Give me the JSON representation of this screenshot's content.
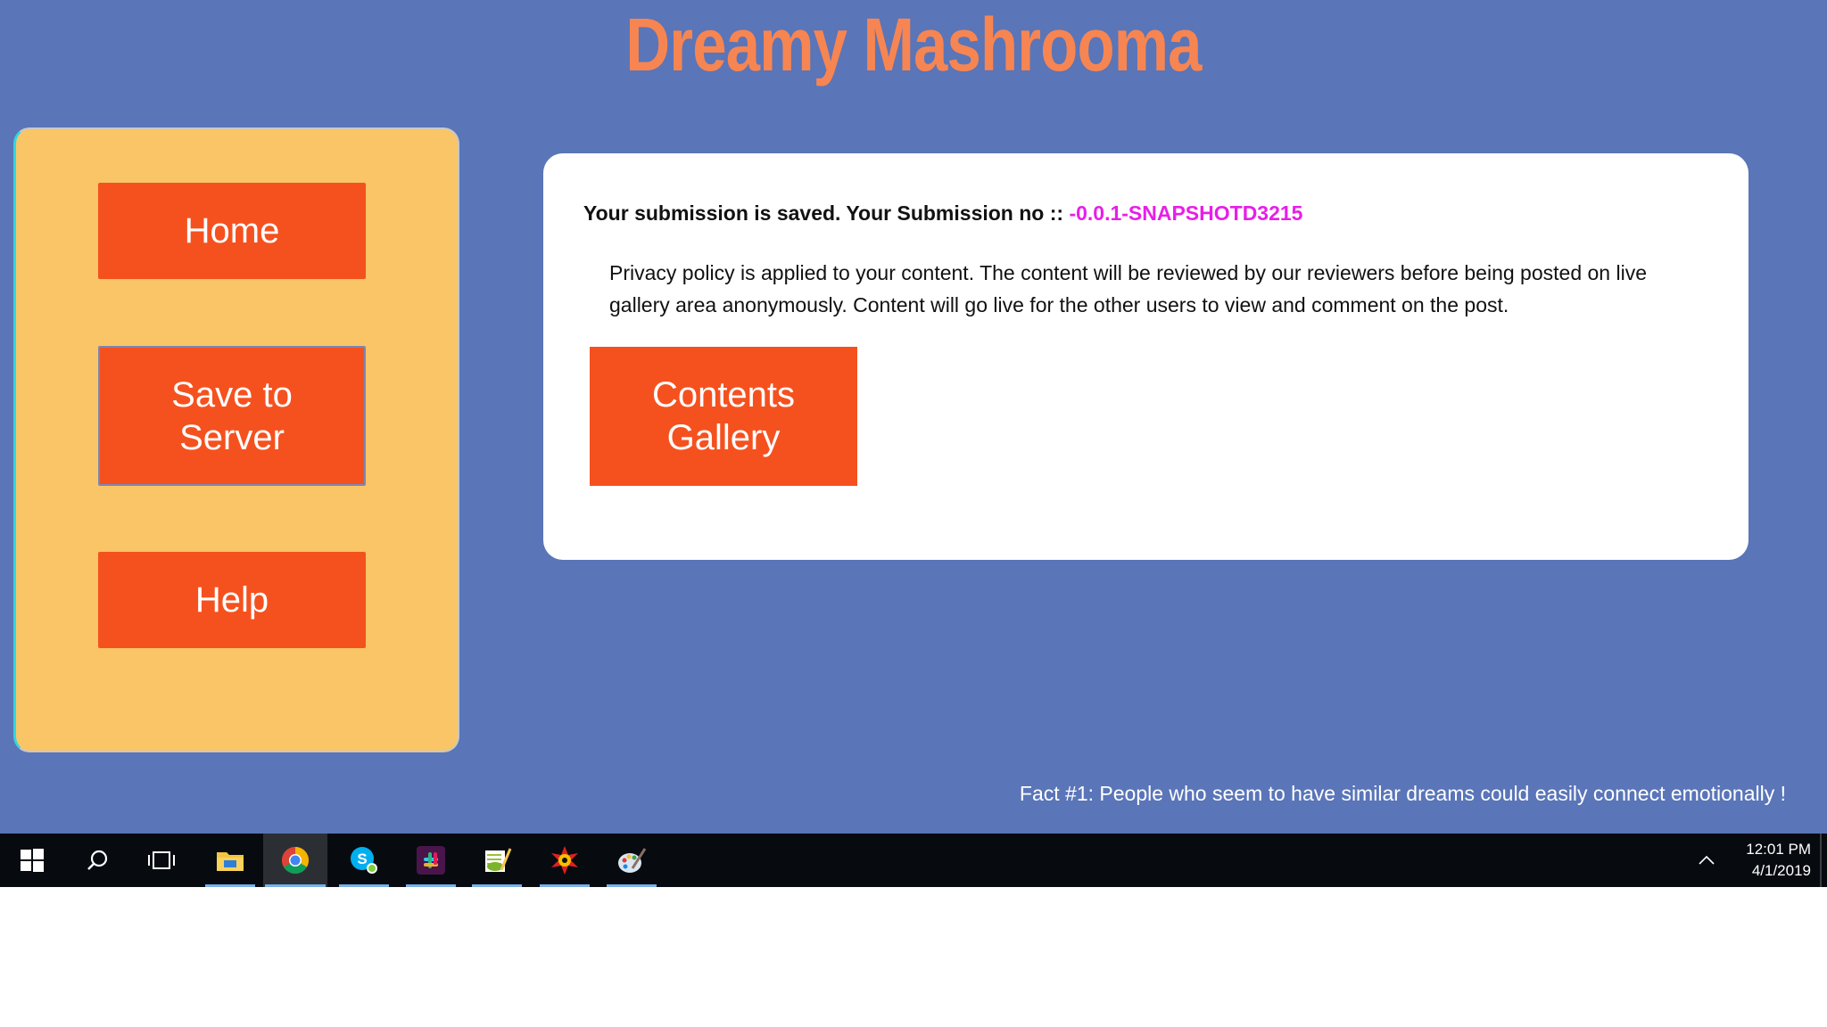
{
  "app": {
    "title": "Dreamy Mashrooma"
  },
  "sidebar": {
    "buttons": [
      {
        "label": "Home"
      },
      {
        "label": "Save to Server"
      },
      {
        "label": "Help"
      }
    ]
  },
  "main": {
    "saved_prefix": "Your submission is saved. Your Submission no :: ",
    "submission_no": "-0.0.1-SNAPSHOTD3215",
    "privacy_text": "Privacy policy is applied to your content. The content will be reviewed by our reviewers before being posted on live gallery area anonymously. Content will go live for the other users to view and comment on the post.",
    "gallery_button": "Contents Gallery"
  },
  "footer": {
    "fact": "Fact #1: People who seem to have similar dreams could easily connect emotionally !"
  },
  "taskbar": {
    "apps": [
      {
        "icon": "windows-start-icon"
      },
      {
        "icon": "search-icon"
      },
      {
        "icon": "task-view-icon"
      },
      {
        "icon": "file-explorer-icon"
      },
      {
        "icon": "chrome-icon"
      },
      {
        "icon": "skype-icon"
      },
      {
        "icon": "slack-icon"
      },
      {
        "icon": "notepad-plus-icon"
      },
      {
        "icon": "nexus-app-icon"
      },
      {
        "icon": "paint-icon"
      }
    ],
    "time": "12:01 PM",
    "date": "4/1/2019"
  },
  "colors": {
    "background": "#5a75b8",
    "title": "#f78552",
    "sidebar": "#f9c566",
    "button": "#f5511f",
    "submission_no": "#e81ee8"
  }
}
